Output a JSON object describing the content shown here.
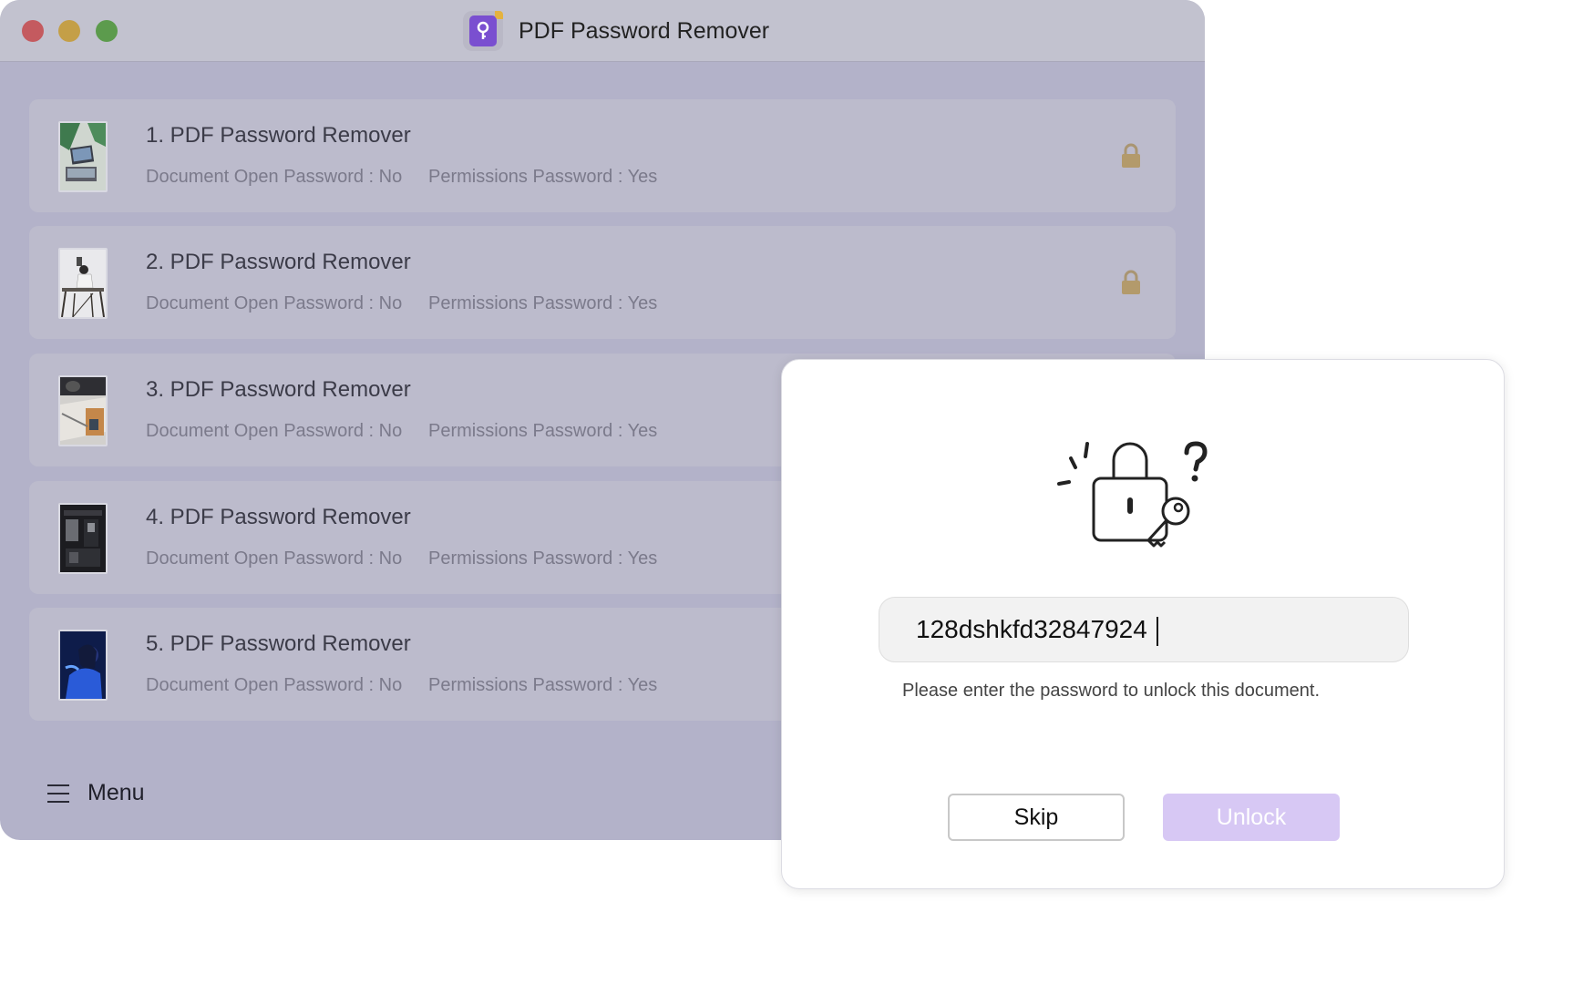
{
  "window": {
    "title": "PDF Password Remover",
    "app_icon": "key-document-icon"
  },
  "files": [
    {
      "name": "1. PDF Password Remover",
      "open_password": "Document Open Password : No",
      "permissions_password": "Permissions Password : Yes",
      "locked": true
    },
    {
      "name": "2. PDF Password Remover",
      "open_password": "Document Open Password : No",
      "permissions_password": "Permissions Password : Yes",
      "locked": true
    },
    {
      "name": "3. PDF Password Remover",
      "open_password": "Document Open Password : No",
      "permissions_password": "Permissions Password : Yes",
      "locked": false
    },
    {
      "name": "4. PDF Password Remover",
      "open_password": "Document Open Password : No",
      "permissions_password": "Permissions Password : Yes",
      "locked": false
    },
    {
      "name": "5. PDF Password Remover",
      "open_password": "Document Open Password : No",
      "permissions_password": "Permissions Password : Yes",
      "locked": false
    }
  ],
  "menu": {
    "label": "Menu",
    "icon": "hamburger-icon"
  },
  "dialog": {
    "illustration": "lock-key-question-icon",
    "password_value": "128dshkfd32847924",
    "hint": "Please enter the password to unlock this document.",
    "skip_label": "Skip",
    "unlock_label": "Unlock"
  },
  "colors": {
    "accent": "#7a4fd0",
    "unlock_disabled": "#d7c8f4",
    "lock": "#b39a6b"
  }
}
